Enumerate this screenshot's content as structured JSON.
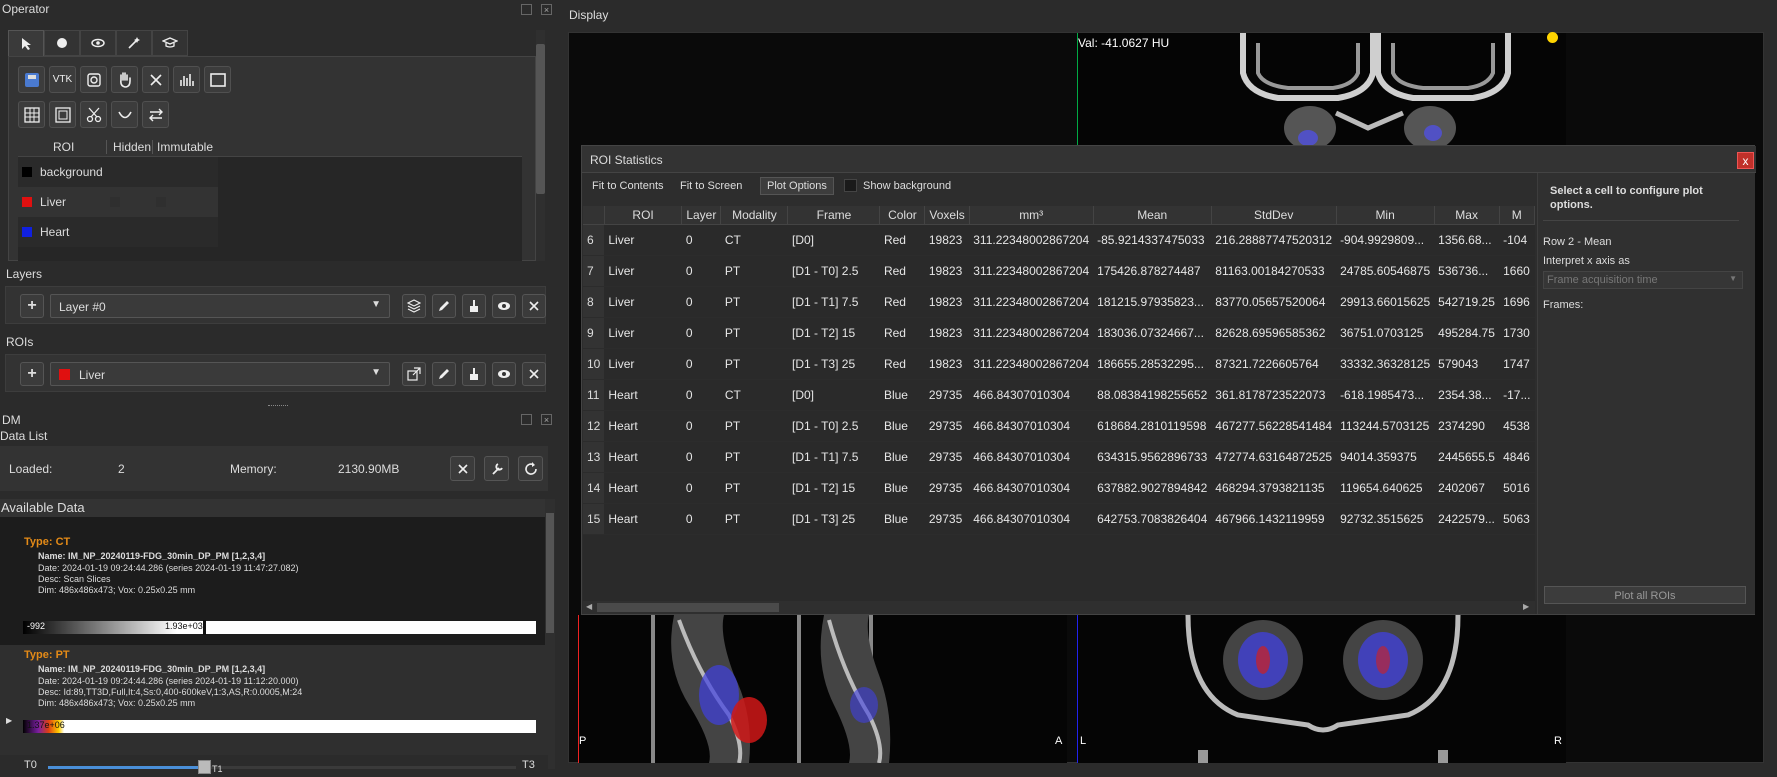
{
  "operator": {
    "title": "Operator",
    "tab_icons": [
      "pointer-icon",
      "circle-icon",
      "eye-icon",
      "magic-wand-icon",
      "graduation-cap-icon"
    ],
    "tool_row1": [
      "save-roi-icon",
      "vtk-icon",
      "rotate-icon",
      "hand-icon",
      "close-icon",
      "histogram-icon",
      "rectangle-icon"
    ],
    "tool_row2": [
      "table-icon",
      "grid-icon",
      "scissors-icon",
      "curve-icon",
      "swap-icon"
    ],
    "vtk_label": "VTK",
    "roi_table": {
      "headers": [
        "ROI",
        "Hidden",
        "Immutable"
      ],
      "rows": [
        {
          "name": "background",
          "color": "#000000"
        },
        {
          "name": "Liver",
          "color": "#e01010"
        },
        {
          "name": "Heart",
          "color": "#1020e0"
        }
      ]
    }
  },
  "layers": {
    "title": "Layers",
    "selected": "Layer #0"
  },
  "rois": {
    "title": "ROIs",
    "selected": "Liver",
    "selected_color": "#e01010"
  },
  "dm": {
    "title": "DM",
    "data_list": "Data List",
    "loaded_label": "Loaded:",
    "loaded_value": "2",
    "memory_label": "Memory:",
    "memory_value": "2130.90MB",
    "available_title": "Available Data",
    "items": [
      {
        "type": "Type: CT",
        "name": "Name: IM_NP_20240119-FDG_30min_DP_PM [1,2,3,4]",
        "date": "Date: 2024-01-19 09:24:44.286 (series 2024-01-19 11:47:27.082)",
        "desc": "Desc: Scan Slices",
        "dim": "Dim: 486x486x473; Vox: 0.25x0.25 mm",
        "bar_min": "-992",
        "bar_max": "1.93e+03"
      },
      {
        "type": "Type: PT",
        "name": "Name: IM_NP_20240119-FDG_30min_DP_PM [1,2,3,4]",
        "date": "Date: 2024-01-19 09:24:44.286 (series 2024-01-19 11:12:20.000)",
        "desc": "Desc: Id:89,TT3D,Full,It:4,Ss:0,400-600keV,1:3,AS,R:0.0005,M:24",
        "dim": "Dim: 486x486x473; Vox: 0.25x0.25 mm",
        "bar_max": "1.37e+06"
      }
    ],
    "slider_start": "T0",
    "slider_mid": "T1",
    "slider_end": "T3",
    "slider_fraction": 0.33
  },
  "display": {
    "title": "Display",
    "val_text": "Val: -41.0627 HU",
    "orient_p": "P",
    "orient_a": "A",
    "orient_l": "L",
    "orient_r": "R"
  },
  "roi_stats": {
    "title": "ROI Statistics",
    "close": "x",
    "fit_contents": "Fit to Contents",
    "fit_screen": "Fit to Screen",
    "plot_options": "Plot Options",
    "show_background": "Show background",
    "columns": [
      "ROI",
      "Layer",
      "Modality",
      "Frame",
      "Color",
      "Voxels",
      "mm³",
      "Mean",
      "StdDev",
      "Min",
      "Max",
      "M"
    ],
    "rows": [
      [
        "6",
        "Liver",
        "0",
        "CT",
        "[D0]",
        "Red",
        "19823",
        "311.22348002867204",
        "-85.9214337475033",
        "216.28887747520312",
        "-904.9929809...",
        "1356.68...",
        "-104"
      ],
      [
        "7",
        "Liver",
        "0",
        "PT",
        "[D1 - T0] 2.5",
        "Red",
        "19823",
        "311.22348002867204",
        "175426.878274487",
        "81163.00184270533",
        "24785.60546875",
        "536736...",
        "1660"
      ],
      [
        "8",
        "Liver",
        "0",
        "PT",
        "[D1 - T1] 7.5",
        "Red",
        "19823",
        "311.22348002867204",
        "181215.97935823...",
        "83770.05657520064",
        "29913.66015625",
        "542719.25",
        "1696"
      ],
      [
        "9",
        "Liver",
        "0",
        "PT",
        "[D1 - T2] 15",
        "Red",
        "19823",
        "311.22348002867204",
        "183036.07324667...",
        "82628.69596585362",
        "36751.0703125",
        "495284.75",
        "1730"
      ],
      [
        "10",
        "Liver",
        "0",
        "PT",
        "[D1 - T3] 25",
        "Red",
        "19823",
        "311.22348002867204",
        "186655.28532295...",
        "87321.7226605764",
        "33332.36328125",
        "579043",
        "1747"
      ],
      [
        "11",
        "Heart",
        "0",
        "CT",
        "[D0]",
        "Blue",
        "29735",
        "466.84307010304",
        "88.08384198255652",
        "361.8178723522073",
        "-618.1985473...",
        "2354.38...",
        "-17..."
      ],
      [
        "12",
        "Heart",
        "0",
        "PT",
        "[D1 - T0] 2.5",
        "Blue",
        "29735",
        "466.84307010304",
        "618684.2810119598",
        "467277.56228541484",
        "113244.5703125",
        "2374290",
        "4538"
      ],
      [
        "13",
        "Heart",
        "0",
        "PT",
        "[D1 - T1] 7.5",
        "Blue",
        "29735",
        "466.84307010304",
        "634315.9562896733",
        "472774.63164872525",
        "94014.359375",
        "2445655.5",
        "4846"
      ],
      [
        "14",
        "Heart",
        "0",
        "PT",
        "[D1 - T2] 15",
        "Blue",
        "29735",
        "466.84307010304",
        "637882.9027894842",
        "468294.3793821135",
        "119654.640625",
        "2402067",
        "5016"
      ],
      [
        "15",
        "Heart",
        "0",
        "PT",
        "[D1 - T3] 25",
        "Blue",
        "29735",
        "466.84307010304",
        "642753.7083826404",
        "467966.1432119959",
        "92732.3515625",
        "2422579...",
        "5063"
      ]
    ],
    "side_title": "Select a cell to configure plot options.",
    "side_row": "Row 2 - Mean",
    "side_interpret": "Interpret x axis as",
    "side_select": "Frame acquisition time",
    "side_frames": "Frames:",
    "plot_all": "Plot all ROIs"
  }
}
